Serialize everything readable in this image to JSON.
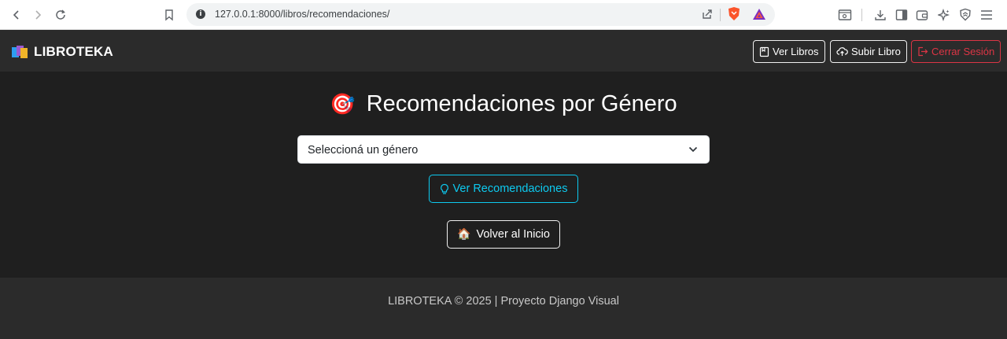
{
  "browser": {
    "url": "127.0.0.1:8000/libros/recomendaciones/",
    "icons": [
      "back-icon",
      "forward-icon",
      "reload-icon",
      "bookmark-icon",
      "site-info-icon",
      "share-icon",
      "brave-shields-icon",
      "brave-rewards-icon",
      "reader-mode-icon",
      "download-icon",
      "sidebar-icon",
      "wallet-icon",
      "leo-ai-icon",
      "vpn-icon",
      "menu-icon"
    ]
  },
  "navbar": {
    "brand": "LIBROTEKA",
    "buttons": [
      {
        "label": "Ver Libros",
        "icon": "book-icon"
      },
      {
        "label": "Subir Libro",
        "icon": "cloud-upload-icon"
      },
      {
        "label": "Cerrar Sesión",
        "icon": "logout-icon"
      }
    ]
  },
  "main": {
    "title_emoji": "🎯",
    "title": "Recomendaciones por Género",
    "select_value": "Seleccioná un género",
    "recommend_button": "Ver Recomendaciones",
    "home_button_emoji": "🏠",
    "home_button": "Volver al Inicio"
  },
  "footer": {
    "text": "LIBROTEKA © 2025 | Proyecto Django Visual"
  },
  "colors": {
    "background": "#1f1f1f",
    "navbar": "#2b2b2b",
    "info": "#0dcaf0",
    "danger": "#dc3545"
  }
}
